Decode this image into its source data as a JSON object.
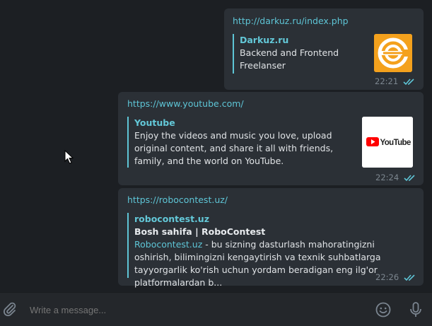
{
  "messages": [
    {
      "url": "http://darkuz.ru/index.php",
      "site": "Darkuz.ru",
      "title": "",
      "description_link": "",
      "description": "Backend and Frontend Freelanser",
      "time": "22:21"
    },
    {
      "url": "https://www.youtube.com/",
      "site": "Youtube",
      "title": "",
      "description_link": "",
      "description": "Enjoy the videos and music you love, upload original content, and share it all with friends, family, and the world on YouTube.",
      "time": "22:24"
    },
    {
      "url": "https://robocontest.uz/",
      "site": "robocontest.uz",
      "title": "Bosh sahifa | RoboContest",
      "description_link": "Robocontest.uz",
      "description": " - bu sizning dasturlash mahoratingizni oshirish, bilimingizni kengaytirish va texnik suhbatlarga tayyorgarlik ko'rish uchun yordam beradigan eng ilg'or platformalardan b...",
      "time": "22:26"
    }
  ],
  "composer": {
    "placeholder": "Write a message..."
  },
  "colors": {
    "accent": "#5ec5d6",
    "bubble": "#2b3036",
    "background": "#1c1f23"
  }
}
